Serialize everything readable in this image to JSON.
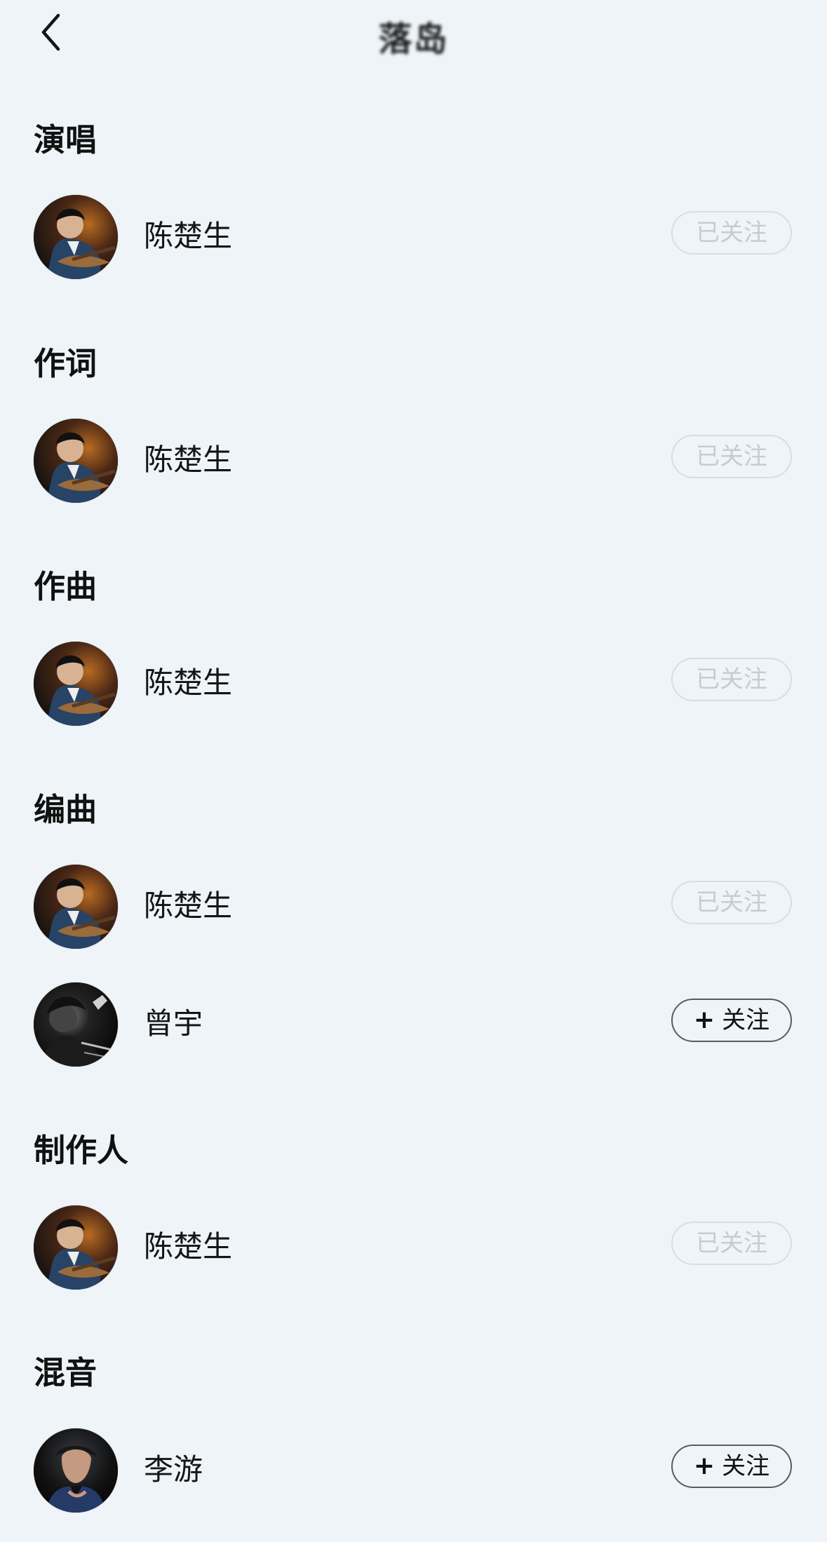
{
  "header": {
    "title": "落岛",
    "back_icon": "chevron-left-icon"
  },
  "sections": [
    {
      "title": "演唱",
      "people": [
        {
          "name": "陈楚生",
          "follow_label": "已关注",
          "followed": true,
          "avatar": "guitar-portrait"
        }
      ]
    },
    {
      "title": "作词",
      "people": [
        {
          "name": "陈楚生",
          "follow_label": "已关注",
          "followed": true,
          "avatar": "guitar-portrait"
        }
      ]
    },
    {
      "title": "作曲",
      "people": [
        {
          "name": "陈楚生",
          "follow_label": "已关注",
          "followed": true,
          "avatar": "guitar-portrait"
        }
      ]
    },
    {
      "title": "编曲",
      "people": [
        {
          "name": "陈楚生",
          "follow_label": "已关注",
          "followed": true,
          "avatar": "guitar-portrait"
        },
        {
          "name": "曾宇",
          "follow_label": "关注",
          "followed": false,
          "plus_icon": "+",
          "avatar": "dark-monochrome-portrait"
        }
      ]
    },
    {
      "title": "制作人",
      "people": [
        {
          "name": "陈楚生",
          "follow_label": "已关注",
          "followed": true,
          "avatar": "guitar-portrait"
        }
      ]
    },
    {
      "title": "混音",
      "people": [
        {
          "name": "李游",
          "follow_label": "关注",
          "followed": false,
          "plus_icon": "+",
          "avatar": "cap-portrait"
        }
      ]
    }
  ],
  "colors": {
    "background": "#eef4f8",
    "text": "#111111",
    "followed_text": "#c6ccd2",
    "followed_border": "#d7dde2",
    "follow_border": "#5b5b5b"
  }
}
